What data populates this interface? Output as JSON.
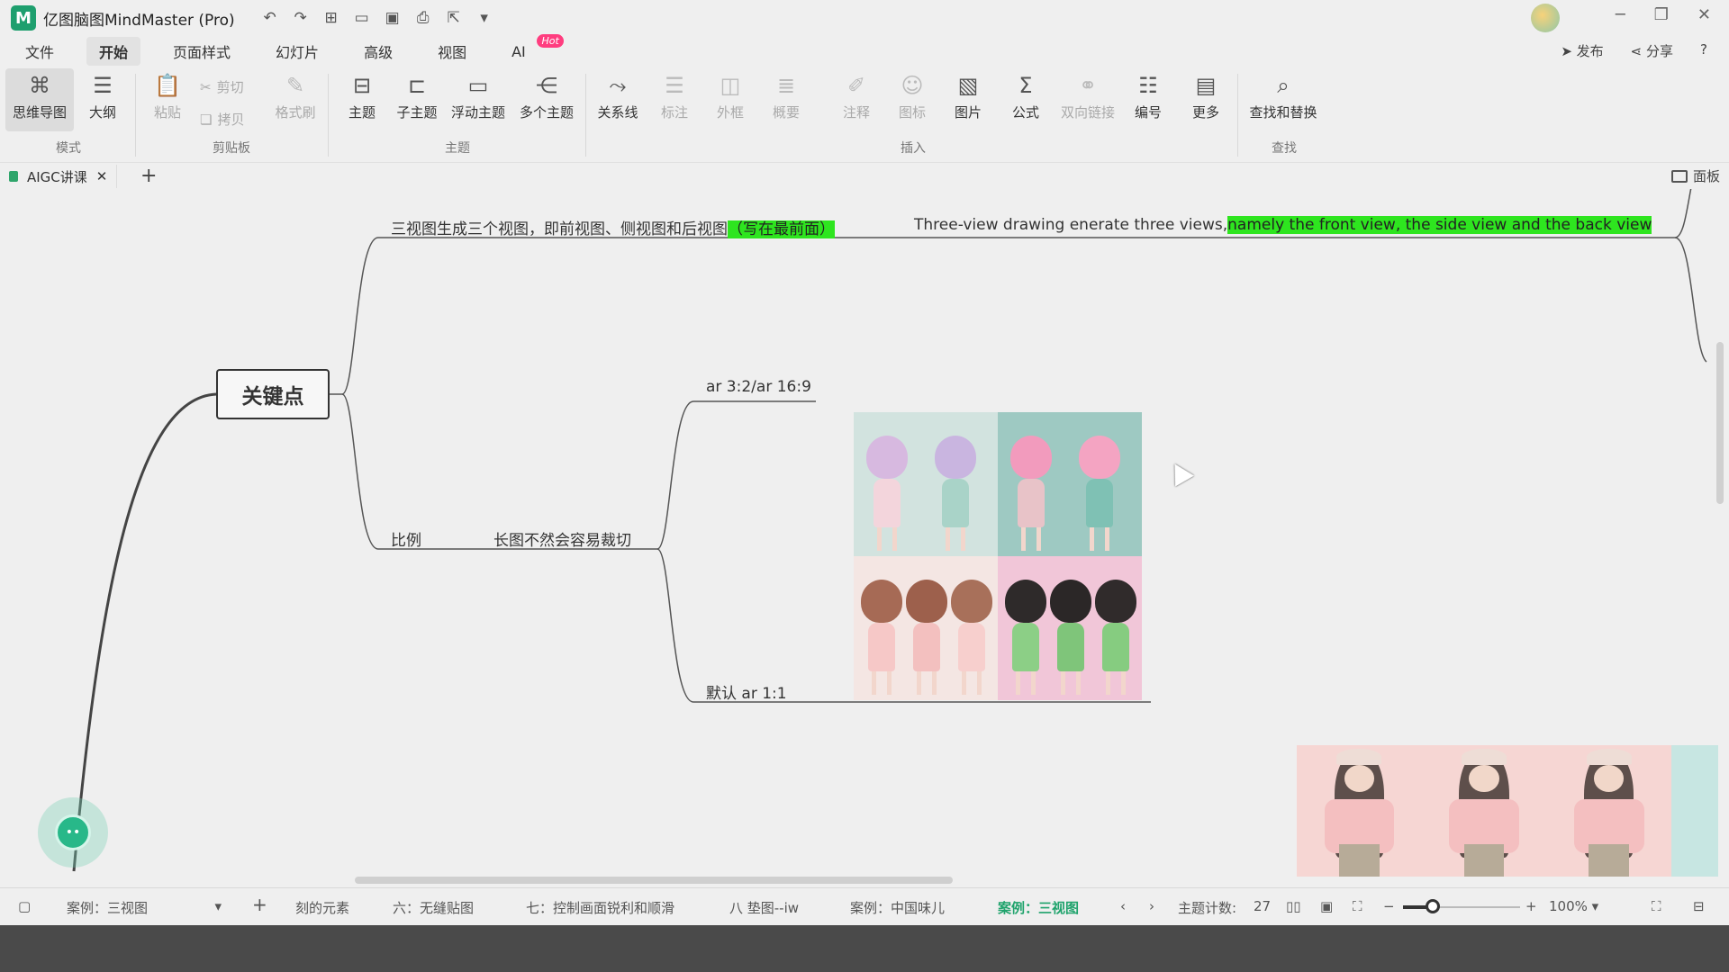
{
  "titlebar": {
    "logo": "M",
    "title": "亿图脑图MindMaster (Pro)",
    "quick_actions": [
      "undo-icon",
      "redo-icon",
      "new-icon",
      "open-icon",
      "save-icon",
      "print-icon",
      "export-icon",
      "more-icon"
    ]
  },
  "menubar": {
    "tabs": [
      "文件",
      "开始",
      "页面样式",
      "幻灯片",
      "高级",
      "视图",
      "AI"
    ],
    "hot_badge": "Hot",
    "publish": "发布",
    "share": "分享"
  },
  "ribbon": {
    "mindmap": "思维导图",
    "outline": "大纲",
    "paste": "粘贴",
    "cut": "剪切",
    "copy": "拷贝",
    "format_painter": "格式刷",
    "topic": "主题",
    "subtopic": "子主题",
    "floating_topic": "浮动主题",
    "multi_topic": "多个主题",
    "relation": "关系线",
    "callout": "标注",
    "boundary": "外框",
    "summary": "概要",
    "note": "注释",
    "icon": "图标",
    "image": "图片",
    "formula": "公式",
    "bilink": "双向链接",
    "numbering": "编号",
    "more": "更多",
    "find_replace": "查找和替换",
    "groups": {
      "mode": "模式",
      "clipboard": "剪贴板",
      "topic": "主题",
      "insert": "插入",
      "find": "查找"
    }
  },
  "doc": {
    "tab_title": "AIGC讲课",
    "panel": "面板"
  },
  "canvas": {
    "root": "关键点",
    "branch1_text": "三视图生成三个视图，即前视图、侧视图和后视图",
    "branch1_highlight": "（写在最前面）",
    "branch1_en_text": "Three-view drawing enerate three views,",
    "branch1_en_highlight": "namely the front view, the side view and the back view",
    "branch2_label": "比例",
    "branch2_sub": "长图不然会容易裁切",
    "leaf_ar": "ar 3:2/ar 16:9",
    "leaf_default": "默认 ar 1:1"
  },
  "statusbar": {
    "sheet_select": "案例：三视图",
    "sheets": [
      "刻的元素",
      "六：无缝贴图",
      "七：控制画面锐利和顺滑",
      "八 垫图--iw",
      "案例：中国味儿",
      "案例：三视图"
    ],
    "topic_count_label": "主题计数:",
    "topic_count": "27",
    "zoom": "100%",
    "zoom_level": 0.25
  },
  "colors": {
    "highlight": "#2ee51f",
    "accent": "#1fa36c",
    "hot": "#ff3d7f"
  }
}
